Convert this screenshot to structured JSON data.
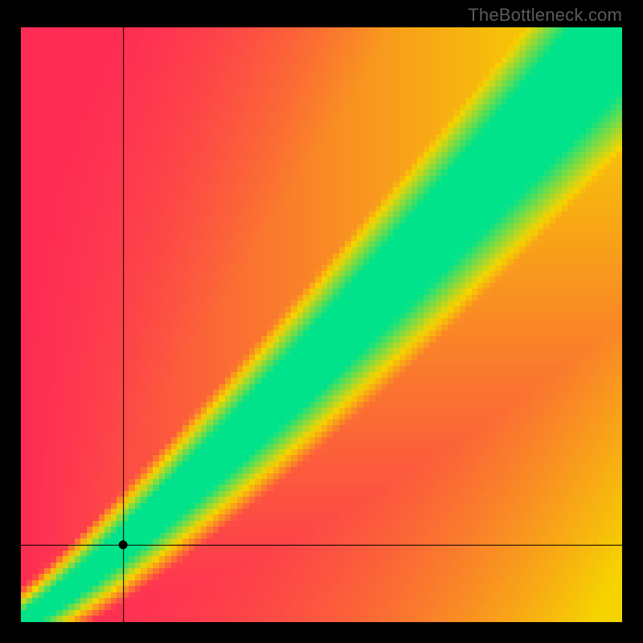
{
  "watermark": "TheBottleneck.com",
  "chart_data": {
    "type": "heatmap",
    "title": "",
    "xlabel": "",
    "ylabel": "",
    "xlim": [
      0,
      100
    ],
    "ylim": [
      0,
      100
    ],
    "x_units": "normalized",
    "y_units": "normalized",
    "pixel_grid": 100,
    "crosshair": {
      "x": 17,
      "y": 13
    },
    "marker": {
      "x": 17,
      "y": 13
    },
    "optimal_band": {
      "description": "Green diagonal band where the y-axis value is approximately proportional to x^1.15, widening toward higher values.",
      "samples_x": [
        0,
        5,
        10,
        15,
        20,
        30,
        40,
        50,
        60,
        70,
        80,
        90,
        100
      ],
      "center_y": [
        0,
        3.5,
        7.2,
        11.2,
        15.5,
        24.8,
        34.8,
        45.5,
        56.7,
        68.3,
        80.2,
        92.5,
        100
      ],
      "lower_y": [
        0,
        2.8,
        5.8,
        9.2,
        12.9,
        21.0,
        30.0,
        39.6,
        49.8,
        60.4,
        71.4,
        82.8,
        90.0
      ],
      "upper_y": [
        0,
        4.1,
        8.6,
        13.3,
        18.2,
        28.6,
        39.7,
        51.3,
        63.5,
        76.1,
        89.1,
        100,
        100
      ]
    },
    "colorscale": [
      {
        "value": 0.0,
        "color": "#ff2c55"
      },
      {
        "value": 0.5,
        "color": "#f6d400"
      },
      {
        "value": 1.0,
        "color": "#00e38a"
      }
    ],
    "legend": null
  }
}
